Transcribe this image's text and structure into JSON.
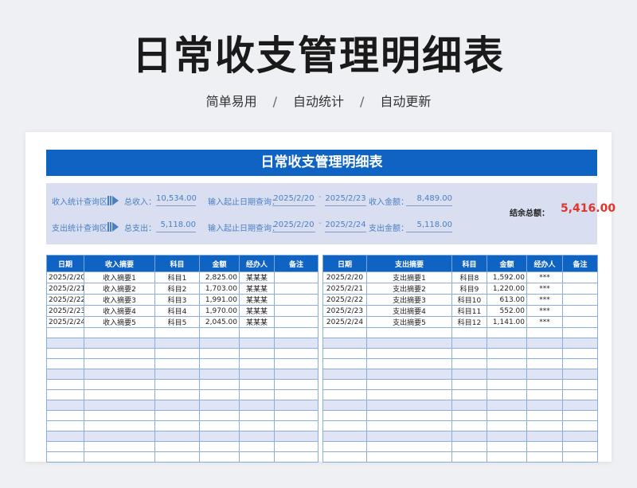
{
  "header": {
    "title": "日常收支管理明细表",
    "subtitle": [
      "简单易用",
      "自动统计",
      "自动更新"
    ],
    "separator": "/"
  },
  "card": {
    "banner_title": "日常收支管理明细表",
    "income_query": {
      "label": "收入统计查询区",
      "total_label": "总收入：",
      "total_value": "10,534.00",
      "date_label": "输入起止日期查询：",
      "date_from": "2025/2/20",
      "date_to": "2025/2/23",
      "amount_label": "收入金额：",
      "amount_value": "8,489.00"
    },
    "expense_query": {
      "label": "支出统计查询区",
      "total_label": "总支出：",
      "total_value": "5,118.00",
      "date_label": "输入起止日期查询：",
      "date_from": "2025/2/20",
      "date_to": "2025/2/24",
      "amount_label": "支出金额：",
      "amount_value": "5,118.00"
    },
    "balance_label": "结余总额：",
    "balance_value": "5,416.00",
    "colors": {
      "accent": "#0f63c3",
      "panel": "#d9dff1",
      "balance": "#e0362a"
    }
  },
  "income_table": {
    "headers": [
      "日期",
      "收入摘要",
      "科目",
      "金额",
      "经办人",
      "备注"
    ],
    "rows": [
      [
        "2025/2/20",
        "收入摘要1",
        "科目1",
        "2,825.00",
        "某某某",
        ""
      ],
      [
        "2025/2/21",
        "收入摘要2",
        "科目2",
        "1,703.00",
        "某某某",
        ""
      ],
      [
        "2025/2/22",
        "收入摘要3",
        "科目3",
        "1,991.00",
        "某某某",
        ""
      ],
      [
        "2025/2/23",
        "收入摘要4",
        "科目4",
        "1,970.00",
        "某某某",
        ""
      ],
      [
        "2025/2/24",
        "收入摘要5",
        "科目5",
        "2,045.00",
        "某某某",
        ""
      ]
    ]
  },
  "expense_table": {
    "headers": [
      "日期",
      "支出摘要",
      "科目",
      "金额",
      "经办人",
      "备注"
    ],
    "rows": [
      [
        "2025/2/20",
        "支出摘要1",
        "科目8",
        "1,592.00",
        "***",
        ""
      ],
      [
        "2025/2/21",
        "支出摘要2",
        "科目9",
        "1,220.00",
        "***",
        ""
      ],
      [
        "2025/2/22",
        "支出摘要3",
        "科目10",
        "613.00",
        "***",
        ""
      ],
      [
        "2025/2/23",
        "支出摘要4",
        "科目11",
        "552.00",
        "***",
        ""
      ],
      [
        "2025/2/24",
        "支出摘要5",
        "科目12",
        "1,141.00",
        "***",
        ""
      ]
    ]
  }
}
